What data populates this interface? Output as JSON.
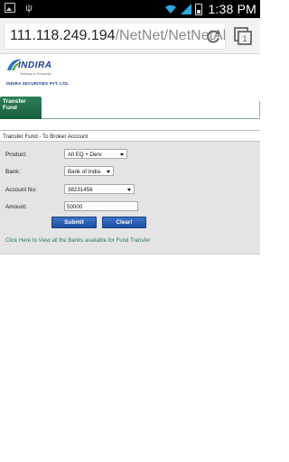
{
  "statusbar": {
    "time": "1:38",
    "time_suffix": "PM",
    "icons": [
      "image-icon",
      "usb-icon",
      "wifi-icon",
      "signal-icon",
      "battery-icon"
    ]
  },
  "browser": {
    "url_host": "111.118.249.194",
    "url_path": "/NetNet/NetNetAll",
    "tab_count": "1"
  },
  "header": {
    "logo_word": "INDIRA",
    "logo_tagline": "Gateway to Prosperity",
    "logo_company": "INDIRA SECURITIES PVT. LTD."
  },
  "tabs": [
    {
      "label": "Transfer Fund",
      "active": true
    }
  ],
  "form": {
    "title": "Transfer Fund - To Broker Account",
    "product_label": "Product:",
    "product_value": "All EQ + Derv",
    "bank_label": "Bank:",
    "bank_value": "Bank of India",
    "account_label": "Account No:",
    "account_value": "38231456",
    "amount_label": "Amount:",
    "amount_value": "50000",
    "submit_label": "Submit",
    "clear_label": "Clear!",
    "banks_link": "Click Here to View all the Banks available for Fund Transfer"
  },
  "colors": {
    "tab_green": "#1d6a45",
    "button_blue": "#2a5fb3",
    "link_green": "#2e7d52",
    "panel_gray": "#e4e4e4"
  }
}
